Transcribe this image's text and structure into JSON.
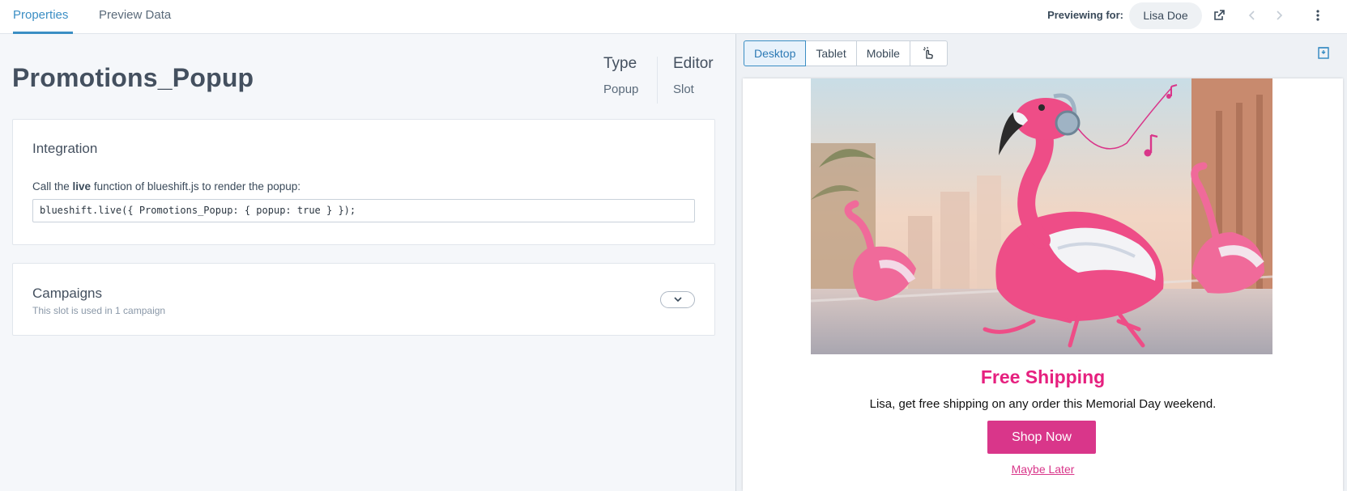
{
  "tabs": [
    {
      "label": "Properties",
      "active": true
    },
    {
      "label": "Preview Data",
      "active": false
    }
  ],
  "header": {
    "previewing_label": "Previewing for:",
    "user": "Lisa Doe",
    "icons": [
      "external-link-icon",
      "chevron-left-icon",
      "chevron-right-icon",
      "more-vertical-icon"
    ]
  },
  "slot": {
    "title": "Promotions_Popup",
    "type_label": "Type",
    "type_value": "Popup",
    "editor_label": "Editor",
    "editor_value": "Slot"
  },
  "integration": {
    "title": "Integration",
    "desc_prefix": "Call the ",
    "desc_bold": "live",
    "desc_suffix": " function of blueshift.js to render the popup:",
    "code": "blueshift.live({ Promotions_Popup: { popup: true } });"
  },
  "campaigns": {
    "title": "Campaigns",
    "subtitle": "This slot is used in 1 campaign"
  },
  "devices": [
    {
      "label": "Desktop",
      "active": true
    },
    {
      "label": "Tablet",
      "active": false
    },
    {
      "label": "Mobile",
      "active": false
    }
  ],
  "popup": {
    "headline": "Free Shipping",
    "body": "Lisa, get free shipping on any order this Memorial Day weekend.",
    "cta": "Shop Now",
    "dismiss": "Maybe Later",
    "accent_color": "#e6207f",
    "button_color": "#d9368a"
  },
  "colors": {
    "primary": "#3b8ec4",
    "text": "#44505f"
  }
}
